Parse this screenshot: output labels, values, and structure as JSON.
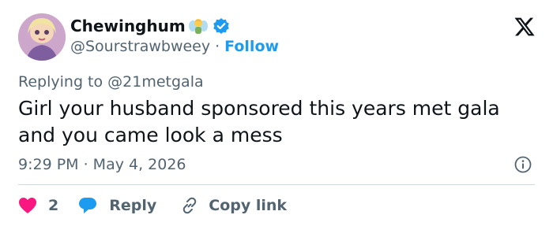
{
  "user": {
    "display_name": "Chewinghum",
    "handle": "@Sourstrawbweey",
    "separator": "·",
    "follow_label": "Follow",
    "name_emoji_icon": "fairy-emoji-icon",
    "verified_icon": "verified-badge-icon"
  },
  "reply_context": {
    "prefix": "Replying to",
    "mention": "@21metgala"
  },
  "tweet": {
    "text_line1": "Girl your husband sponsored this years met gala",
    "text_line2": "and you came look a mess",
    "timestamp": "9:29 PM · May 4, 2026"
  },
  "actions": {
    "like_count": "2",
    "reply_label": "Reply",
    "copy_link_label": "Copy link"
  },
  "colors": {
    "accent": "#1d9bf0",
    "like": "#f91880",
    "muted": "#536471",
    "text": "#0f1419"
  }
}
